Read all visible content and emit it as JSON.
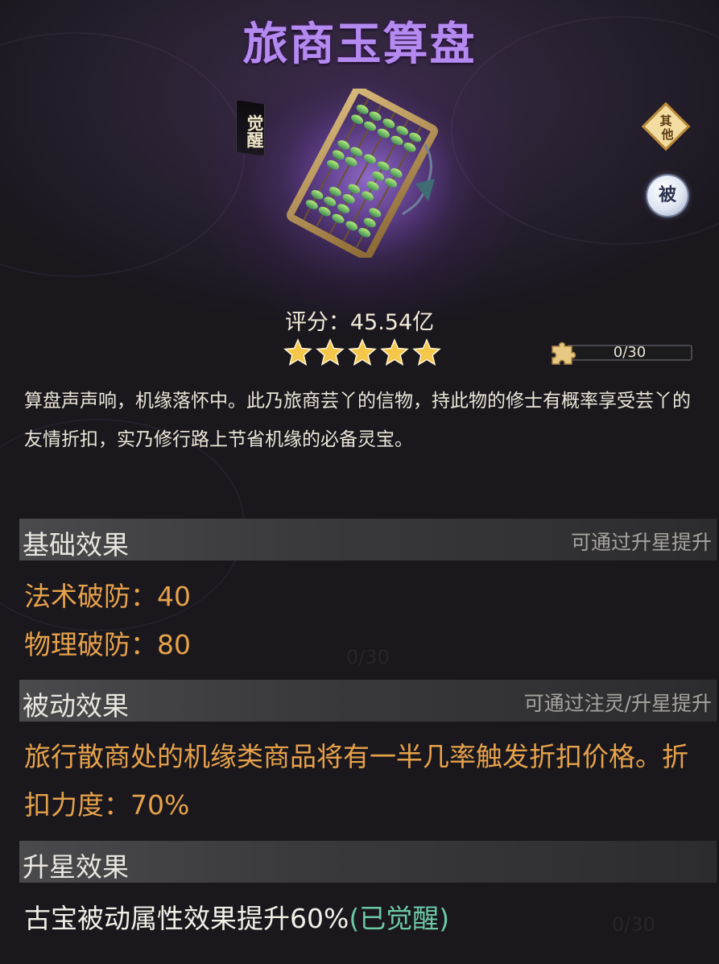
{
  "item": {
    "name": "旅商玉算盘",
    "awaken_tag": "觉醒",
    "score_label": "评分：",
    "score_value": "45.54亿",
    "stars": 5,
    "progress_text": "0/30",
    "progress_fraction": 0
  },
  "badges": {
    "other": "其他",
    "passive": "被"
  },
  "description": "算盘声声响，机缘落怀中。此乃旅商芸丫的信物，持此物的修士有概率享受芸丫的友情折扣，实乃修行路上节省机缘的必备灵宝。",
  "base_effect": {
    "title": "基础效果",
    "hint": "可通过升星提升",
    "stats": [
      {
        "label": "法术破防：",
        "value": "40"
      },
      {
        "label": "物理破防：",
        "value": "80"
      }
    ]
  },
  "passive_effect": {
    "title": "被动效果",
    "hint": "可通过注灵/升星提升",
    "text": "旅行散商处的机缘类商品将有一半几率触发折扣价格。折扣力度：70%"
  },
  "star_effect": {
    "title": "升星效果",
    "text": "古宝被动属性效果提升60%",
    "status": "(已觉醒)"
  },
  "colors": {
    "title": "#b489f0",
    "stat": "#e6a24a",
    "awakened": "#6cc9a6",
    "star": "#f4c64a"
  },
  "icons": {
    "item": "abacus-icon",
    "fragment": "puzzle-piece-icon",
    "star": "star-icon"
  }
}
